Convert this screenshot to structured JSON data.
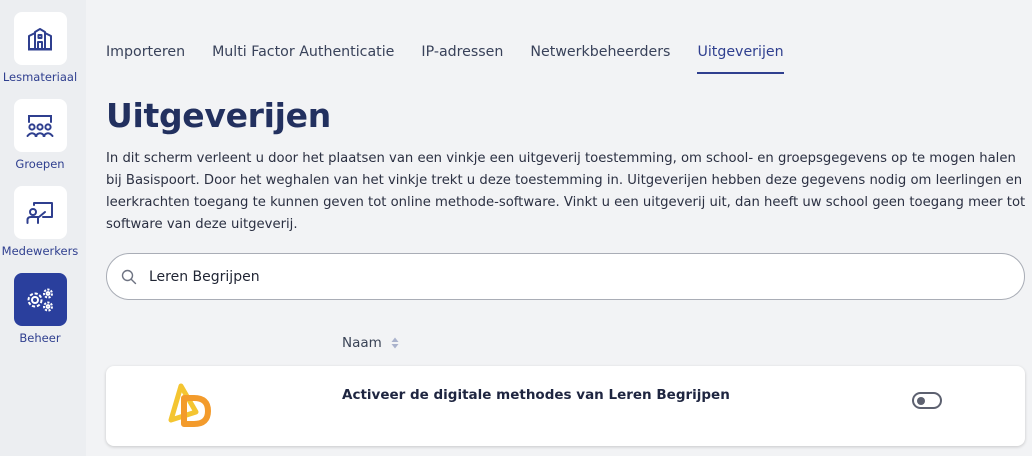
{
  "sidebar": {
    "items": [
      {
        "label": "Lesmateriaal",
        "icon": "school-building-icon",
        "active": false
      },
      {
        "label": "Groepen",
        "icon": "group-people-icon",
        "active": false
      },
      {
        "label": "Medewerkers",
        "icon": "teacher-board-icon",
        "active": false
      },
      {
        "label": "Beheer",
        "icon": "gears-icon",
        "active": true
      }
    ]
  },
  "tabs": [
    {
      "label": "Importeren",
      "active": false
    },
    {
      "label": "Multi Factor Authenticatie",
      "active": false
    },
    {
      "label": "IP-adressen",
      "active": false
    },
    {
      "label": "Netwerkbeheerders",
      "active": false
    },
    {
      "label": "Uitgeverijen",
      "active": true
    }
  ],
  "page": {
    "title": "Uitgeverijen",
    "intro": "In dit scherm verleent u door het plaatsen van een vinkje een uitgeverij toestemming, om school- en groepsgegevens op te mogen halen bij Basispoort. Door het weghalen van het vinkje trekt u deze toestemming in. Uitgeverijen hebben deze gegevens nodig om leerlingen en leerkrachten toegang te kunnen geven tot online methode-software. Vinkt u een uitgeverij uit, dan heeft uw school geen toegang meer tot software van deze uitgeverij."
  },
  "search": {
    "value": "Leren Begrijpen"
  },
  "table": {
    "column_name": "Naam",
    "rows": [
      {
        "name": "Activeer de digitale methodes van Leren Begrijpen",
        "enabled": false
      }
    ]
  },
  "colors": {
    "accent": "#2f3f8f",
    "active_tile": "#2a3f9d",
    "logo_yellow": "#f4c531",
    "logo_orange": "#f39b2c"
  }
}
